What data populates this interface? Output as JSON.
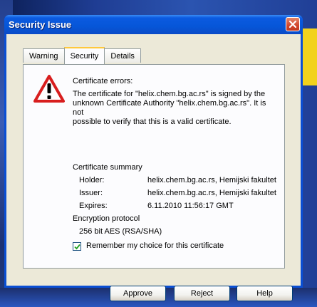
{
  "dialog": {
    "title": "Security Issue",
    "tabs": [
      {
        "label": "Warning"
      },
      {
        "label": "Security",
        "active": true
      },
      {
        "label": "Details"
      }
    ],
    "errors_heading": "Certificate errors:",
    "error_lines": [
      "The certificate for \"helix.chem.bg.ac.rs\" is signed by the",
      "unknown Certificate Authority \"helix.chem.bg.ac.rs\". It is not",
      "possible to verify that this is a valid certificate."
    ],
    "summary_heading": "Certificate summary",
    "holder_label": "Holder:",
    "holder_value": "helix.chem.bg.ac.rs, Hemijski fakultet",
    "issuer_label": "Issuer:",
    "issuer_value": "helix.chem.bg.ac.rs, Hemijski fakultet",
    "expires_label": "Expires:",
    "expires_value": "6.11.2010 11:56:17 GMT",
    "encryption_heading": "Encryption protocol",
    "encryption_value": "256 bit AES (RSA/SHA)",
    "remember_label": "Remember my choice for this certificate",
    "remember_checked": true,
    "buttons": {
      "approve": "Approve",
      "reject": "Reject",
      "help": "Help"
    }
  },
  "icons": {
    "warning": "warning-triangle-icon",
    "close": "close-icon",
    "check": "checkmark-icon"
  },
  "colors": {
    "title_bar": "#0a56d8",
    "warning_red": "#d81e1e",
    "close_red": "#d1452b",
    "tab_highlight": "#ffc83c"
  }
}
